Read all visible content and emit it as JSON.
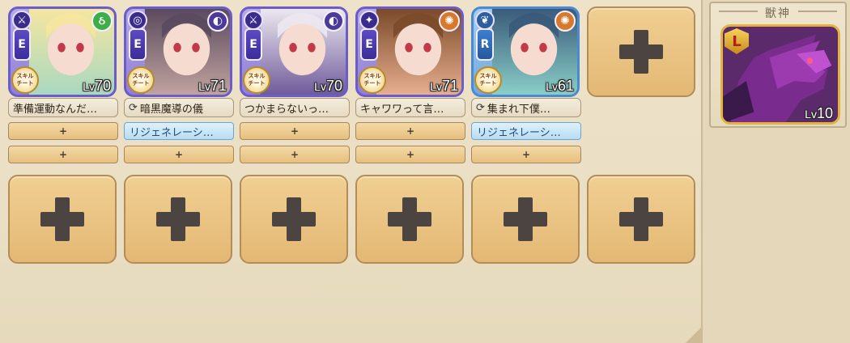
{
  "units": [
    {
      "rarity": "E",
      "level_prefix": "Lv",
      "level": "70",
      "skill": "準備運動なんだ…",
      "skill_icon": false,
      "attr_color": "#3fae4a",
      "attr_glyph": "ઠ",
      "class_glyph": "⚔",
      "skill_badge": "スキル\nチート",
      "frame": "e",
      "bg1": "#f5e6a0",
      "bg2": "#a8d8c0",
      "accessory_1": "+",
      "accessory_2": "+",
      "accessory_1_blue": false
    },
    {
      "rarity": "E",
      "level_prefix": "Lv",
      "level": "71",
      "skill": "暗黒魔導の儀",
      "skill_icon": true,
      "attr_color": "#4c3a9a",
      "attr_glyph": "◐",
      "class_glyph": "◎",
      "skill_badge": "スキル\nチート",
      "frame": "e",
      "bg1": "#5a4a5e",
      "bg2": "#c2a4a0",
      "accessory_1": "リジェネレーシ…",
      "accessory_2": "+",
      "accessory_1_blue": true
    },
    {
      "rarity": "E",
      "level_prefix": "Lv",
      "level": "70",
      "skill": "つかまらないっ…",
      "skill_icon": false,
      "attr_color": "#4c3a9a",
      "attr_glyph": "◐",
      "class_glyph": "⚔",
      "skill_badge": "スキル\nチート",
      "frame": "e",
      "bg1": "#ece8f0",
      "bg2": "#6e5a9a",
      "accessory_1": "+",
      "accessory_2": "+",
      "accessory_1_blue": false
    },
    {
      "rarity": "E",
      "level_prefix": "Lv",
      "level": "71",
      "skill": "キャワワって言…",
      "skill_icon": false,
      "attr_color": "#d8782a",
      "attr_glyph": "✺",
      "class_glyph": "✦",
      "skill_badge": "スキル\nチート",
      "frame": "e",
      "bg1": "#7a4a2a",
      "bg2": "#e8b090",
      "accessory_1": "+",
      "accessory_2": "+",
      "accessory_1_blue": false
    },
    {
      "rarity": "R",
      "level_prefix": "Lv",
      "level": "61",
      "skill": "集まれ下僕…",
      "skill_icon": true,
      "attr_color": "#d8782a",
      "attr_glyph": "✺",
      "class_glyph": "❦",
      "skill_badge": "スキル\nチート",
      "frame": "r",
      "bg1": "#3a5a7a",
      "bg2": "#8ad0c8",
      "accessory_1": "リジェネレーシ…",
      "accessory_2": "+",
      "accessory_1_blue": true
    }
  ],
  "empty_unit_slot_icon": "plus-icon",
  "beast": {
    "title": "獣神",
    "badge": "L",
    "level_prefix": "Lv",
    "level": "10"
  },
  "colors": {
    "parchment": "#eadfc4",
    "slot_fill": "#e9c688",
    "plus": "#4b4440"
  }
}
